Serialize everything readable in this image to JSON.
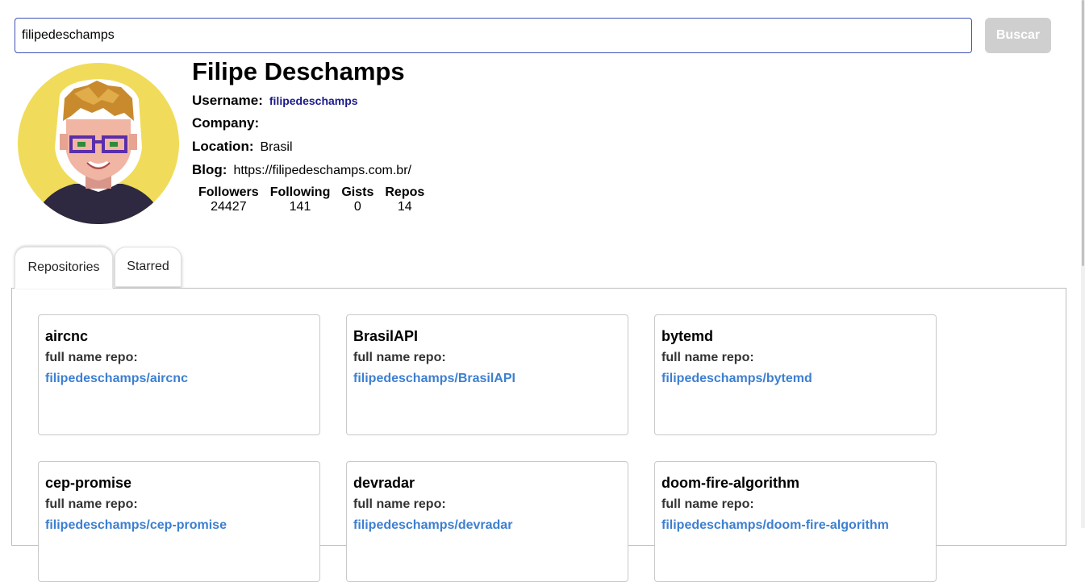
{
  "search": {
    "value": "filipedeschamps",
    "button_label": "Buscar"
  },
  "profile": {
    "name": "Filipe Deschamps",
    "username_label": "Username:",
    "username": "filipedeschamps",
    "company_label": "Company:",
    "company": "",
    "location_label": "Location:",
    "location": "Brasil",
    "blog_label": "Blog:",
    "blog": "https://filipedeschamps.com.br/"
  },
  "stats": [
    {
      "label": "Followers",
      "value": "24427"
    },
    {
      "label": "Following",
      "value": "141"
    },
    {
      "label": "Gists",
      "value": "0"
    },
    {
      "label": "Repos",
      "value": "14"
    }
  ],
  "tabs": [
    {
      "label": "Repositories",
      "active": true
    },
    {
      "label": "Starred",
      "active": false
    }
  ],
  "repos": [
    {
      "name": "aircnc",
      "full_name_label": "full name repo:",
      "full_name": "filipedeschamps/aircnc"
    },
    {
      "name": "BrasilAPI",
      "full_name_label": "full name repo:",
      "full_name": "filipedeschamps/BrasilAPI"
    },
    {
      "name": "bytemd",
      "full_name_label": "full name repo:",
      "full_name": "filipedeschamps/bytemd"
    },
    {
      "name": "cep-promise",
      "full_name_label": "full name repo:",
      "full_name": "filipedeschamps/cep-promise"
    },
    {
      "name": "devradar",
      "full_name_label": "full name repo:",
      "full_name": "filipedeschamps/devradar"
    },
    {
      "name": "doom-fire-algorithm",
      "full_name_label": "full name repo:",
      "full_name": "filipedeschamps/doom-fire-algorithm"
    }
  ],
  "colors": {
    "accent": "#3f51b5",
    "link": "#3d7fd1",
    "username": "#1a1a8a",
    "button_disabled": "#cfcfcf",
    "avatar_bg": "#f0dc5a"
  },
  "icons": {
    "avatar": "pixel-art-avatar"
  }
}
